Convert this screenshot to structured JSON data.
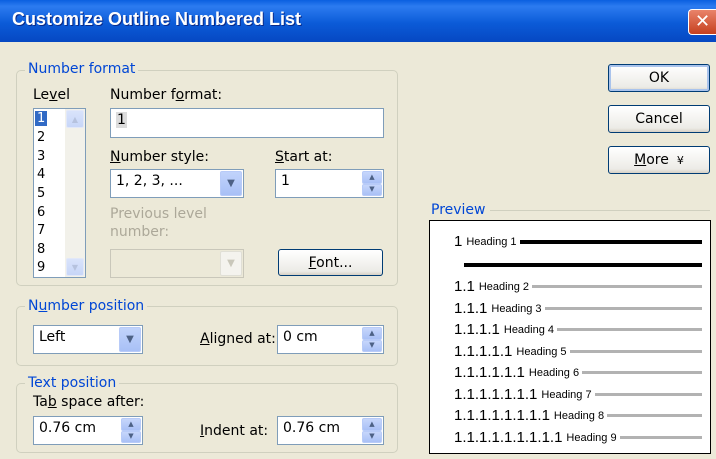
{
  "window": {
    "title": "Customize Outline Numbered List",
    "close_glyph": "✕"
  },
  "number_format_group": {
    "legend": "Number format",
    "level_label_pre": "Le",
    "level_label_key": "v",
    "level_label_post": "el",
    "levels": [
      "1",
      "2",
      "3",
      "4",
      "5",
      "6",
      "7",
      "8",
      "9"
    ],
    "selected_level": "1",
    "number_format_label_pre": "Number f",
    "number_format_label_key": "o",
    "number_format_label_post": "rmat:",
    "number_format_value": "1",
    "number_style_label_key": "N",
    "number_style_label_post": "umber style:",
    "number_style_value": "1, 2, 3, ...",
    "start_at_label_key": "S",
    "start_at_label_post": "tart at:",
    "start_at_value": "1",
    "previous_level_label_line1": "Previous level",
    "previous_level_label_line2": "number:",
    "font_button_key": "F",
    "font_button_post": "ont..."
  },
  "number_position_group": {
    "legend_pre": "N",
    "legend_key": "u",
    "legend_post": "mber position",
    "alignment_value": "Left",
    "aligned_at_label_key": "A",
    "aligned_at_label_post": "ligned at:",
    "aligned_at_value": "0 cm"
  },
  "text_position_group": {
    "legend": "Text position",
    "tab_space_label_pre": "Ta",
    "tab_space_label_key": "b",
    "tab_space_label_post": " space after:",
    "tab_space_value": "0.76 cm",
    "indent_at_label_key": "I",
    "indent_at_label_post": "ndent at:",
    "indent_at_value": "0.76 cm"
  },
  "buttons": {
    "ok": "OK",
    "cancel": "Cancel",
    "more_key": "M",
    "more_post": "ore",
    "more_arrow": "¥"
  },
  "preview": {
    "legend": "Preview",
    "lines": [
      {
        "number": "1",
        "heading": "Heading 1"
      },
      {
        "number": "1.1",
        "heading": "Heading 2"
      },
      {
        "number": "1.1.1",
        "heading": "Heading 3"
      },
      {
        "number": "1.1.1.1",
        "heading": "Heading 4"
      },
      {
        "number": "1.1.1.1.1",
        "heading": "Heading 5"
      },
      {
        "number": "1.1.1.1.1.1",
        "heading": "Heading 6"
      },
      {
        "number": "1.1.1.1.1.1.1",
        "heading": "Heading 7"
      },
      {
        "number": "1.1.1.1.1.1.1.1",
        "heading": "Heading 8"
      },
      {
        "number": "1.1.1.1.1.1.1.1.1",
        "heading": "Heading 9"
      }
    ]
  },
  "icons": {
    "dropdown_arrow": "▼",
    "spin_up": "▲",
    "spin_down": "▼",
    "scroll_up": "▲",
    "scroll_down": "▼"
  }
}
